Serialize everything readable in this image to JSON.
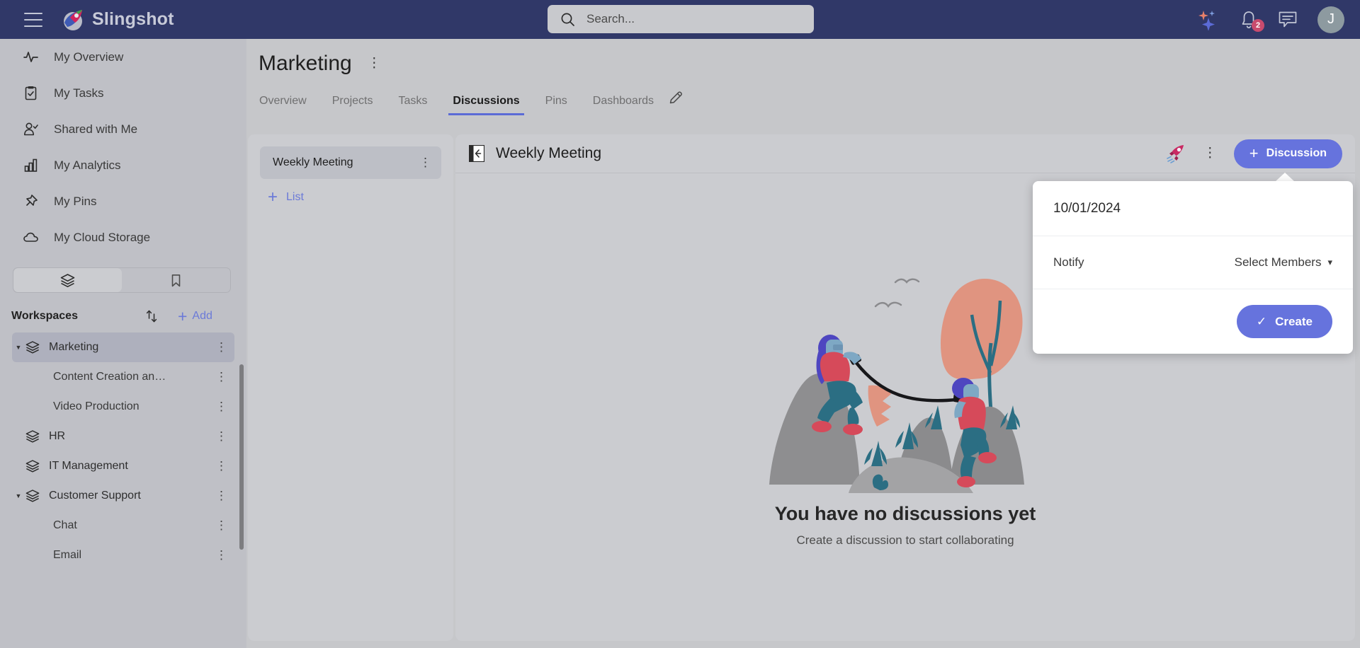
{
  "topbar": {
    "menu_icon": "hamburger-icon",
    "brand": "Slingshot",
    "search_placeholder": "Search...",
    "search_icon": "search-icon",
    "ai_icon": "sparkles-icon",
    "notifications_icon": "bell-icon",
    "notifications_count": "2",
    "messages_icon": "chat-icon",
    "avatar_initial": "J"
  },
  "sidebar": {
    "nav": [
      {
        "label": "My Overview",
        "icon": "activity-icon"
      },
      {
        "label": "My Tasks",
        "icon": "clipboard-check-icon"
      },
      {
        "label": "Shared with Me",
        "icon": "user-check-icon"
      },
      {
        "label": "My Analytics",
        "icon": "bar-chart-icon"
      },
      {
        "label": "My Pins",
        "icon": "pin-icon"
      },
      {
        "label": "My Cloud Storage",
        "icon": "cloud-icon"
      }
    ],
    "view_toggle": [
      {
        "icon": "layers-icon",
        "active": true
      },
      {
        "icon": "bookmark-icon",
        "active": false
      }
    ],
    "workspaces_title": "Workspaces",
    "sort_icon": "sort-arrows-icon",
    "add_label": "Add",
    "workspaces": [
      {
        "label": "Marketing",
        "level": 0,
        "expanded": true,
        "selected": true
      },
      {
        "label": "Content Creation an…",
        "level": 1,
        "selected": false
      },
      {
        "label": "Video Production",
        "level": 1,
        "selected": false
      },
      {
        "label": "HR",
        "level": 0,
        "expanded": false,
        "selected": false
      },
      {
        "label": "IT Management",
        "level": 0,
        "expanded": false,
        "selected": false
      },
      {
        "label": "Customer Support",
        "level": 0,
        "expanded": true,
        "selected": false
      },
      {
        "label": "Chat",
        "level": 1,
        "selected": false
      },
      {
        "label": "Email",
        "level": 1,
        "selected": false
      }
    ]
  },
  "page": {
    "title": "Marketing",
    "tabs": [
      {
        "label": "Overview",
        "active": false
      },
      {
        "label": "Projects",
        "active": false
      },
      {
        "label": "Tasks",
        "active": false
      },
      {
        "label": "Discussions",
        "active": true
      },
      {
        "label": "Pins",
        "active": false
      },
      {
        "label": "Dashboards",
        "active": false
      }
    ],
    "edit_icon": "pencil-icon"
  },
  "list_panel": {
    "items": [
      {
        "label": "Weekly Meeting",
        "selected": true
      }
    ],
    "add_label": "List"
  },
  "main": {
    "collapse_icon": "collapse-panel-icon",
    "title": "Weekly Meeting",
    "rocket_icon": "rocket-icon",
    "more_icon": "more-vertical-icon",
    "new_button": "Discussion",
    "empty_title": "You have no discussions yet",
    "empty_subtitle": "Create a discussion to start collaborating",
    "illustration": "two-climbers-mountain-illustration"
  },
  "popover": {
    "date": "10/01/2024",
    "notify_label": "Notify",
    "notify_value": "Select Members",
    "chevron_icon": "chevron-down-icon",
    "create_label": "Create",
    "check_icon": "check-icon"
  },
  "colors": {
    "header_navy": "#303868",
    "accent_blue": "#6673dd",
    "sidebar_bg": "#bfc0c6",
    "panel_bg": "#cbccd0",
    "page_bg": "#c6c7ca",
    "badge_pink": "#c84b6e",
    "illustration_salmon": "#e09480",
    "illustration_teal": "#2b6e83",
    "illustration_red": "#d64a5a",
    "illustration_purple": "#5b56c4"
  }
}
